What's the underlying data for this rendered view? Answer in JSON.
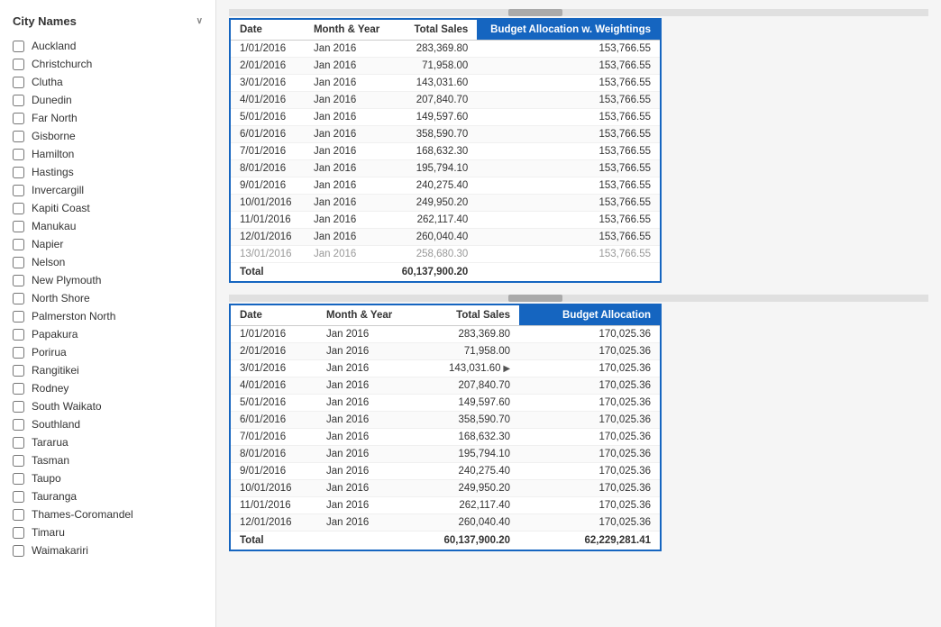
{
  "sidebar": {
    "title": "City Names",
    "cities": [
      "Auckland",
      "Christchurch",
      "Clutha",
      "Dunedin",
      "Far North",
      "Gisborne",
      "Hamilton",
      "Hastings",
      "Invercargill",
      "Kapiti Coast",
      "Manukau",
      "Napier",
      "Nelson",
      "New Plymouth",
      "North Shore",
      "Palmerston North",
      "Papakura",
      "Porirua",
      "Rangitikei",
      "Rodney",
      "South Waikato",
      "Southland",
      "Tararua",
      "Tasman",
      "Taupo",
      "Tauranga",
      "Thames-Coromandel",
      "Timaru",
      "Waimakariri"
    ]
  },
  "table1": {
    "columns": [
      "Date",
      "Month & Year",
      "Total Sales",
      "Budget Allocation w. Weightings"
    ],
    "rows": [
      [
        "1/01/2016",
        "Jan 2016",
        "283,369.80",
        "153,766.55"
      ],
      [
        "2/01/2016",
        "Jan 2016",
        "71,958.00",
        "153,766.55"
      ],
      [
        "3/01/2016",
        "Jan 2016",
        "143,031.60",
        "153,766.55"
      ],
      [
        "4/01/2016",
        "Jan 2016",
        "207,840.70",
        "153,766.55"
      ],
      [
        "5/01/2016",
        "Jan 2016",
        "149,597.60",
        "153,766.55"
      ],
      [
        "6/01/2016",
        "Jan 2016",
        "358,590.70",
        "153,766.55"
      ],
      [
        "7/01/2016",
        "Jan 2016",
        "168,632.30",
        "153,766.55"
      ],
      [
        "8/01/2016",
        "Jan 2016",
        "195,794.10",
        "153,766.55"
      ],
      [
        "9/01/2016",
        "Jan 2016",
        "240,275.40",
        "153,766.55"
      ],
      [
        "10/01/2016",
        "Jan 2016",
        "249,950.20",
        "153,766.55"
      ],
      [
        "11/01/2016",
        "Jan 2016",
        "262,117.40",
        "153,766.55"
      ],
      [
        "12/01/2016",
        "Jan 2016",
        "260,040.40",
        "153,766.55"
      ],
      [
        "13/01/2016",
        "Jan 2016",
        "258,680.30",
        "153,766.55"
      ]
    ],
    "total_label": "Total",
    "total_sales": "60,137,900.20",
    "total_budget": ""
  },
  "table2": {
    "columns": [
      "Date",
      "Month & Year",
      "Total Sales",
      "Budget Allocation"
    ],
    "rows": [
      [
        "1/01/2016",
        "Jan 2016",
        "283,369.80",
        "170,025.36"
      ],
      [
        "2/01/2016",
        "Jan 2016",
        "71,958.00",
        "170,025.36"
      ],
      [
        "3/01/2016",
        "Jan 2016",
        "143,031.60",
        "170,025.36"
      ],
      [
        "4/01/2016",
        "Jan 2016",
        "207,840.70",
        "170,025.36"
      ],
      [
        "5/01/2016",
        "Jan 2016",
        "149,597.60",
        "170,025.36"
      ],
      [
        "6/01/2016",
        "Jan 2016",
        "358,590.70",
        "170,025.36"
      ],
      [
        "7/01/2016",
        "Jan 2016",
        "168,632.30",
        "170,025.36"
      ],
      [
        "8/01/2016",
        "Jan 2016",
        "195,794.10",
        "170,025.36"
      ],
      [
        "9/01/2016",
        "Jan 2016",
        "240,275.40",
        "170,025.36"
      ],
      [
        "10/01/2016",
        "Jan 2016",
        "249,950.20",
        "170,025.36"
      ],
      [
        "11/01/2016",
        "Jan 2016",
        "262,117.40",
        "170,025.36"
      ],
      [
        "12/01/2016",
        "Jan 2016",
        "260,040.40",
        "170,025.36"
      ]
    ],
    "total_label": "Total",
    "total_sales": "60,137,900.20",
    "total_budget": "62,229,281.41"
  }
}
